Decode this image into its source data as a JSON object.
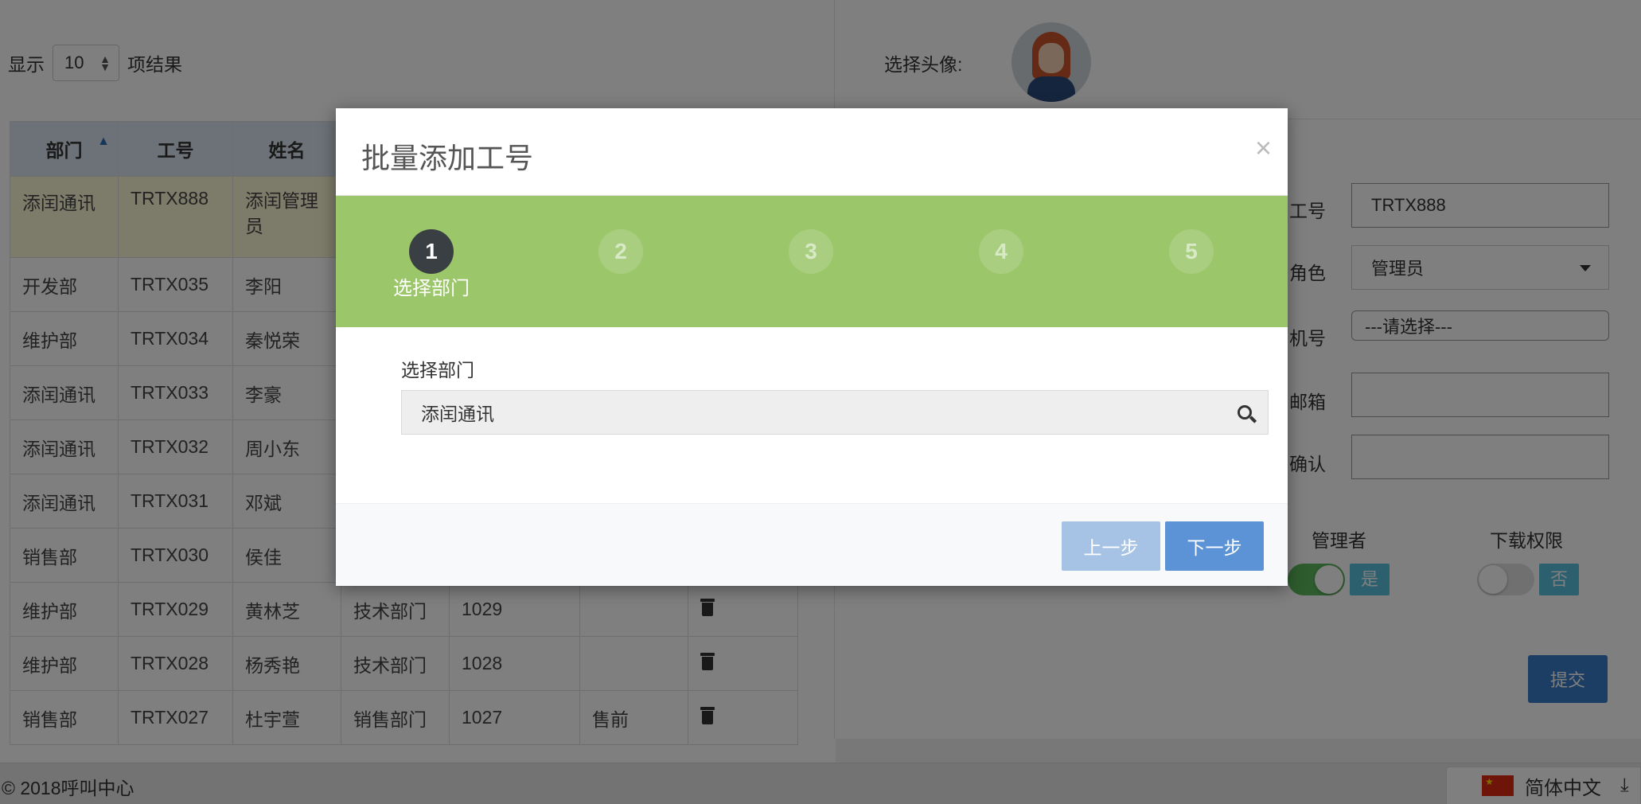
{
  "table_controls": {
    "show_label": "显示",
    "page_size": "10",
    "results_label": "项结果"
  },
  "table": {
    "headers": [
      "部门",
      "工号",
      "姓名"
    ],
    "rows": [
      {
        "dept": "添闰通讯",
        "id": "TRTX888",
        "name": "添闰管理员",
        "group": "",
        "ext": "",
        "note": "",
        "highlight": true
      },
      {
        "dept": "开发部",
        "id": "TRTX035",
        "name": "李阳"
      },
      {
        "dept": "维护部",
        "id": "TRTX034",
        "name": "秦悦荣"
      },
      {
        "dept": "添闰通讯",
        "id": "TRTX033",
        "name": "李豪"
      },
      {
        "dept": "添闰通讯",
        "id": "TRTX032",
        "name": "周小东"
      },
      {
        "dept": "添闰通讯",
        "id": "TRTX031",
        "name": "邓斌"
      },
      {
        "dept": "销售部",
        "id": "TRTX030",
        "name": "侯佳"
      },
      {
        "dept": "维护部",
        "id": "TRTX029",
        "name": "黄林芝",
        "group": "技术部门",
        "ext": "1029",
        "note": ""
      },
      {
        "dept": "维护部",
        "id": "TRTX028",
        "name": "杨秀艳",
        "group": "技术部门",
        "ext": "1028",
        "note": ""
      },
      {
        "dept": "销售部",
        "id": "TRTX027",
        "name": "杜宇萱",
        "group": "销售部门",
        "ext": "1027",
        "note": "售前"
      }
    ]
  },
  "profile_form": {
    "avatar_label": "选择头像:",
    "id_label": "工号",
    "id_value": "TRTX888",
    "role_label": "角色",
    "role_value": "管理员",
    "ext_label": "机号",
    "ext_value": "---请选择---",
    "email_label": "邮箱",
    "confirm_label": "确认",
    "manager_label": "管理者",
    "manager_toggle": "是",
    "download_label": "下载权限",
    "download_toggle": "否",
    "submit_label": "提交"
  },
  "footer": {
    "copyright": "© 2018呼叫中心",
    "language": "简体中文"
  },
  "modal": {
    "title": "批量添加工号",
    "close": "×",
    "steps": [
      "1",
      "2",
      "3",
      "4",
      "5"
    ],
    "active_step_label": "选择部门",
    "field_label": "选择部门",
    "field_value": "添闰通讯",
    "prev_label": "上一步",
    "next_label": "下一步"
  },
  "colors": {
    "step_bar": "#9bc66a",
    "active_step": "#3a3f44",
    "next_button": "#5c93d6",
    "prev_button": "#a6c3e6"
  }
}
